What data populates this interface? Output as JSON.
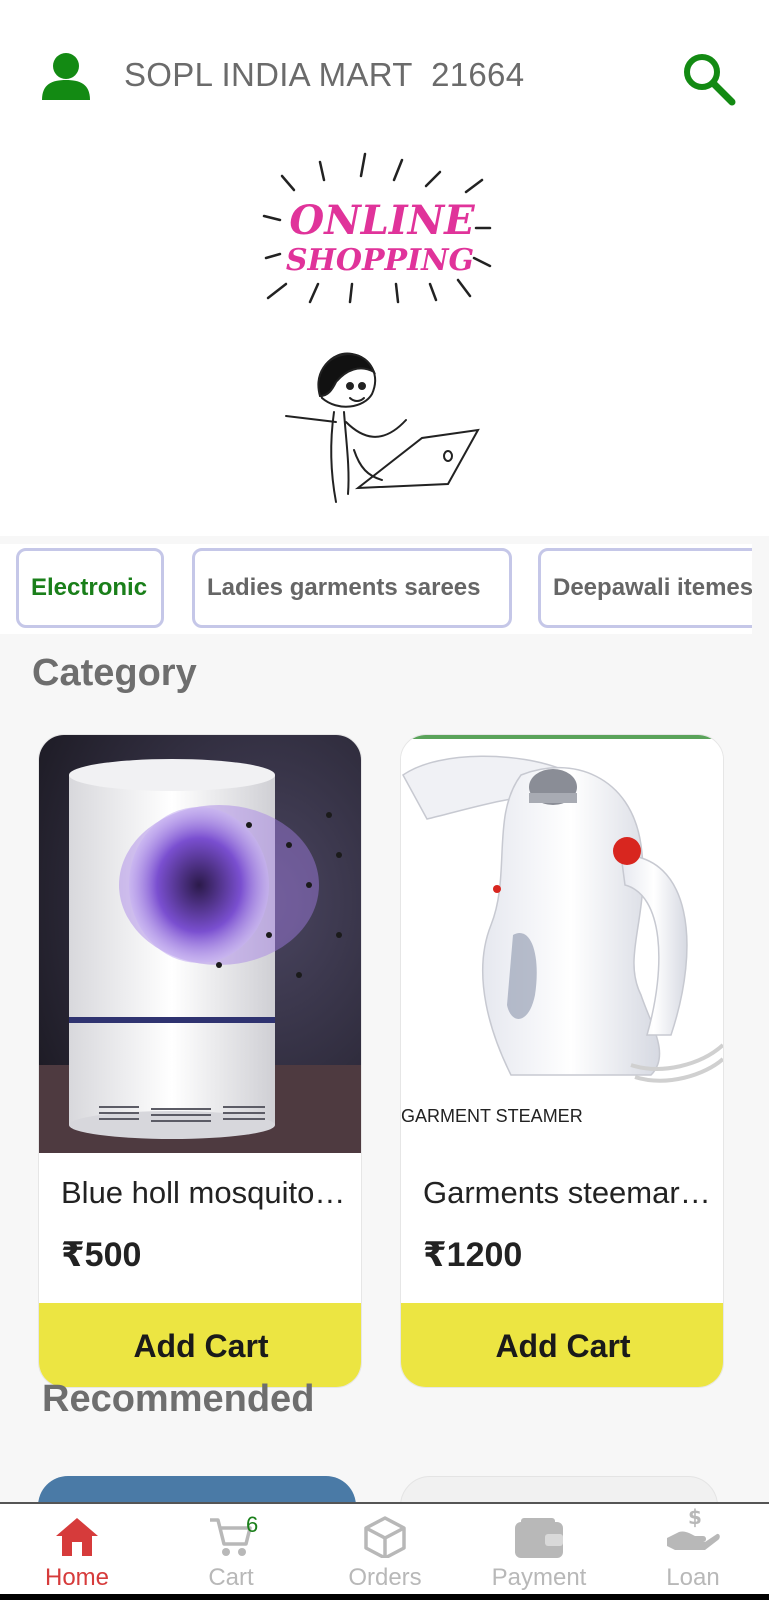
{
  "header": {
    "store_name": "SOPL INDIA MART  21664",
    "user_icon": "person-icon",
    "search_icon": "search-icon",
    "accent_color": "#138a13"
  },
  "banner": {
    "line1": "ONLINE",
    "line2": "SHOPPING",
    "color": "#e0339a"
  },
  "chips": [
    {
      "label": "Electronic",
      "active": true
    },
    {
      "label": "Ladies garments sarees",
      "active": false
    },
    {
      "label": "Deepawali itemes",
      "active": false
    }
  ],
  "sections": {
    "category_title": "Category",
    "recommended_title": "Recommended"
  },
  "products": [
    {
      "title": "Blue holl mosquito…",
      "price": "₹500",
      "button": "Add Cart",
      "image_icon": "mosquito-lamp-image"
    },
    {
      "title": "Garments steemar i…",
      "price": "₹1200",
      "button": "Add Cart",
      "image_icon": "garment-steamer-image",
      "image_caption": "GARMENT STEAMER"
    }
  ],
  "bottom_nav": [
    {
      "label": "Home",
      "icon": "home-icon",
      "active": true
    },
    {
      "label": "Cart",
      "icon": "cart-icon",
      "badge": "6"
    },
    {
      "label": "Orders",
      "icon": "box-icon"
    },
    {
      "label": "Payment",
      "icon": "wallet-icon"
    },
    {
      "label": "Loan",
      "icon": "loan-icon"
    }
  ],
  "colors": {
    "add_button": "#ece542",
    "active_nav": "#d63b3b",
    "chip_border": "#c5c7e8"
  }
}
